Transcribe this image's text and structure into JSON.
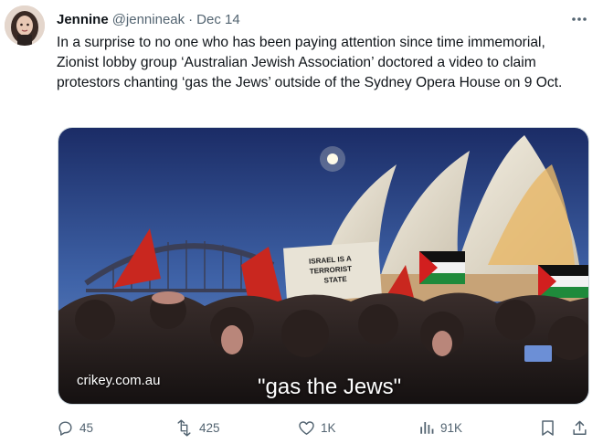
{
  "tweet": {
    "author_name": "Jennine",
    "author_handle": "@jennineak",
    "separator": "·",
    "date": "Dec 14",
    "text": "In a surprise to no one who has been paying attention since time immemorial, Zionist lobby group ‘Australian Jewish Association’ doctored a video to claim protestors chanting ‘gas the Jews’ outside of the Sydney Opera House on 9 Oct."
  },
  "media": {
    "source_label": "crikey.com.au",
    "caption": "\"gas the Jews\"",
    "banner_text": "ISRAEL IS A TERRORIST STATE"
  },
  "actions": {
    "reply_count": "45",
    "repost_count": "425",
    "like_count": "1K",
    "views_count": "91K"
  },
  "icons": {
    "more": "more-dots-icon",
    "reply": "reply-icon",
    "repost": "repost-icon",
    "like": "heart-icon",
    "views": "views-icon",
    "bookmark": "bookmark-icon",
    "share": "share-icon"
  },
  "colors": {
    "text": "#0f1419",
    "secondary": "#536471",
    "border": "#cfd9de"
  }
}
